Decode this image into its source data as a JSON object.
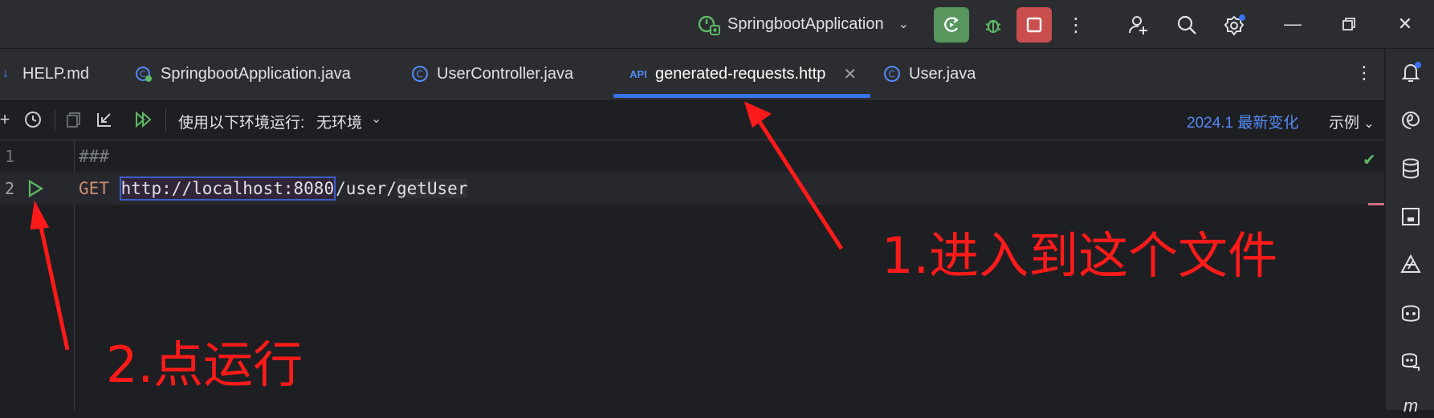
{
  "titlebar": {
    "run_config": "SpringbootApplication"
  },
  "tabs": [
    {
      "label": "HELP.md",
      "icon": "markdown-icon"
    },
    {
      "label": "SpringbootApplication.java",
      "icon": "spring-class-icon"
    },
    {
      "label": "UserController.java",
      "icon": "class-icon"
    },
    {
      "label": "generated-requests.http",
      "icon": "api-http-icon",
      "active": true
    },
    {
      "label": "User.java",
      "icon": "class-icon"
    }
  ],
  "toolbar": {
    "env_label": "使用以下环境运行:",
    "env_value": "无环境",
    "whats_new": "2024.1 最新变化",
    "examples": "示例"
  },
  "editor": {
    "lines": [
      {
        "number": "1",
        "text": "###"
      },
      {
        "number": "2",
        "method": "GET",
        "host": "http://localhost:8080",
        "path": "/user/",
        "ident": "getUser"
      }
    ]
  },
  "annotations": {
    "step1": "1.进入到这个文件",
    "step2": "2.点运行"
  },
  "colors": {
    "accent": "#3574f0",
    "annotation": "#ff1a1a",
    "run_green": "#57965c",
    "stop_red": "#c94f4f"
  }
}
